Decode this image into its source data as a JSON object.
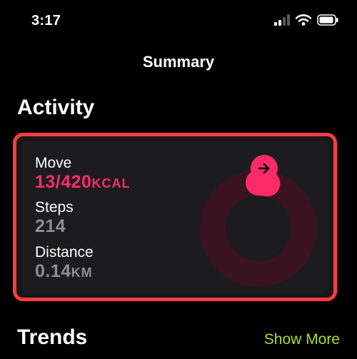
{
  "status_bar": {
    "time": "3:17"
  },
  "nav": {
    "title": "Summary"
  },
  "activity": {
    "section_title": "Activity",
    "move": {
      "label": "Move",
      "value": "13/420",
      "unit": "KCAL",
      "progress_fraction": 0.031
    },
    "steps": {
      "label": "Steps",
      "value": "214"
    },
    "distance": {
      "label": "Distance",
      "value": "0.14",
      "unit": "KM"
    }
  },
  "trends": {
    "section_title": "Trends",
    "show_more_label": "Show More"
  },
  "colors": {
    "background": "#000000",
    "move_accent": "#ff2a68",
    "highlight_border": "#ff3b47",
    "show_more": "#a4e02b",
    "secondary_text": "#8e8e93"
  },
  "icons": [
    "cellular-signal-icon",
    "wifi-icon",
    "battery-icon",
    "arrow-right-icon"
  ]
}
